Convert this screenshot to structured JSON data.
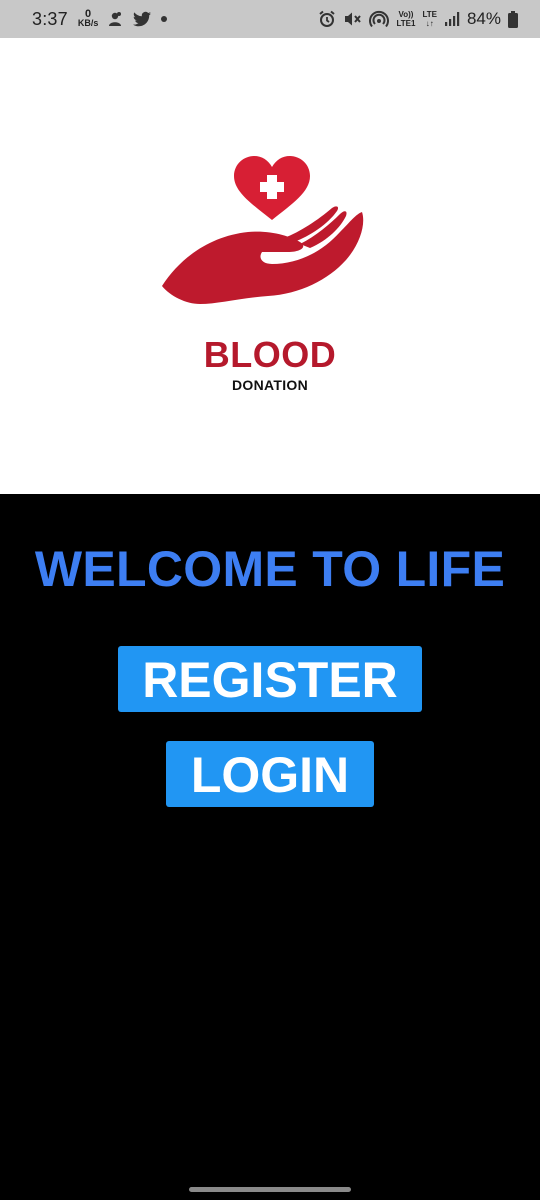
{
  "status_bar": {
    "time": "3:37",
    "net_speed_value": "0",
    "net_speed_unit": "KB/s",
    "volte_top": "Vo))",
    "volte_bottom": "LTE1",
    "lte_top": "LTE",
    "lte_bottom": "↓↑",
    "battery_percent": "84%",
    "icons": [
      "data-saver-icon",
      "twitter-icon",
      "notification-dot-icon",
      "alarm-icon",
      "mute-icon",
      "hotspot-icon",
      "signal-icon",
      "battery-icon"
    ]
  },
  "logo": {
    "title": "BLOOD",
    "subtitle": "DONATION",
    "brand_color": "#b5192c"
  },
  "main": {
    "welcome_text": "WELCOME TO LIFE",
    "register_label": "REGISTER",
    "login_label": "LOGIN",
    "accent_color": "#3d7ef2",
    "button_color": "#2196f3"
  }
}
